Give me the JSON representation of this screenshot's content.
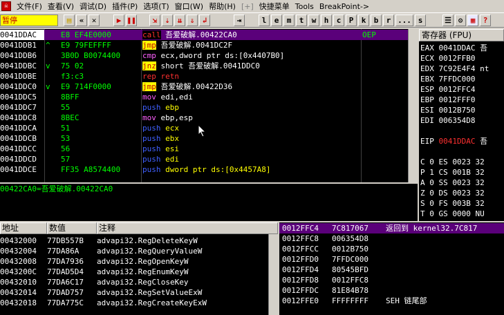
{
  "menu": {
    "app_icon": "app-logo-icon",
    "items": [
      "文件(F)",
      "查看(V)",
      "调试(D)",
      "插件(P)",
      "选项(T)",
      "窗口(W)",
      "帮助(H)",
      "[+]",
      "快捷菜单",
      "Tools",
      "BreakPoint->"
    ]
  },
  "toolbar": {
    "status": "暂停",
    "letters": [
      "l",
      "e",
      "m",
      "t",
      "w",
      "h",
      "c",
      "P",
      "k",
      "b",
      "r",
      "...",
      "s"
    ]
  },
  "disasm": {
    "rows": [
      {
        "addr": "0041DDAC",
        "mark": "",
        "hex": "E8 EF4E0000",
        "kw": "call",
        "kwclass": "kw-call",
        "op": " 吾爱破解.00422CA0",
        "cmt": "OEP",
        "sel": true
      },
      {
        "addr": "0041DDB1",
        "mark": "^",
        "hex": "E9 79FEFFFF",
        "kw": "jmp",
        "kwclass": "kw-jmp",
        "op": " 吾爱破解.0041DC2F",
        "cmt": "",
        "sel": false
      },
      {
        "addr": "0041DDB6",
        "mark": "",
        "hex": "3B0D B0074400",
        "kw": "cmp",
        "kwclass": "kw-cmp",
        "op": " ecx,dword ptr ds:[0x4407B0]",
        "cmt": "",
        "sel": false
      },
      {
        "addr": "0041DDBC",
        "mark": "v",
        "hex": "75 02",
        "kw": "jnz",
        "kwclass": "kw-jmp",
        "op": " short 吾爱破解.0041DDC0",
        "cmt": "",
        "sel": false
      },
      {
        "addr": "0041DDBE",
        "mark": "",
        "hex": "f3:c3",
        "kw": "rep retn",
        "kwclass": "kw-call",
        "op": "",
        "cmt": "",
        "sel": false
      },
      {
        "addr": "0041DDC0",
        "mark": "v",
        "hex": "E9 714F0000",
        "kw": "jmp",
        "kwclass": "kw-jmp",
        "op": " 吾爱破解.00422D36",
        "cmt": "",
        "sel": false
      },
      {
        "addr": "0041DDC5",
        "mark": "",
        "hex": "8BFF",
        "kw": "mov",
        "kwclass": "kw-mov",
        "op": " edi,edi",
        "cmt": "",
        "sel": false
      },
      {
        "addr": "0041DDC7",
        "mark": "",
        "hex": "55",
        "kw": "push",
        "kwclass": "kw-push",
        "op": " ebp",
        "cmt": "",
        "sel": false
      },
      {
        "addr": "0041DDC8",
        "mark": "",
        "hex": "8BEC",
        "kw": "mov",
        "kwclass": "kw-mov",
        "op": " ebp,esp",
        "cmt": "",
        "sel": false
      },
      {
        "addr": "0041DDCA",
        "mark": "",
        "hex": "51",
        "kw": "push",
        "kwclass": "kw-push",
        "op": " ecx",
        "cmt": "",
        "sel": false
      },
      {
        "addr": "0041DDCB",
        "mark": "",
        "hex": "53",
        "kw": "push",
        "kwclass": "kw-push",
        "op": " ebx",
        "cmt": "",
        "sel": false
      },
      {
        "addr": "0041DDCC",
        "mark": "",
        "hex": "56",
        "kw": "push",
        "kwclass": "kw-push",
        "op": " esi",
        "cmt": "",
        "sel": false
      },
      {
        "addr": "0041DDCD",
        "mark": "",
        "hex": "57",
        "kw": "push",
        "kwclass": "kw-push",
        "op": " edi",
        "cmt": "",
        "sel": false
      },
      {
        "addr": "0041DDCE",
        "mark": "",
        "hex": "FF35 A8574400",
        "kw": "push",
        "kwclass": "kw-push",
        "op": " dword ptr ds:[0x4457A8]",
        "cmt": "",
        "sel": false
      }
    ]
  },
  "info": {
    "line": "00422CA0=吾爱破解.00422CA0"
  },
  "registers": {
    "title": "寄存器 (FPU)",
    "rows": [
      {
        "name": "EAX",
        "val": "0041DDAC",
        "extra": " 吾",
        "red": false
      },
      {
        "name": "ECX",
        "val": "0012FFB0",
        "extra": "",
        "red": false
      },
      {
        "name": "EDX",
        "val": "7C92E4F4",
        "extra": " nt",
        "red": false
      },
      {
        "name": "EBX",
        "val": "7FFDC000",
        "extra": "",
        "red": false
      },
      {
        "name": "ESP",
        "val": "0012FFC4",
        "extra": "",
        "red": false
      },
      {
        "name": "EBP",
        "val": "0012FFF0",
        "extra": "",
        "red": false
      },
      {
        "name": "ESI",
        "val": "0012B750",
        "extra": "",
        "red": false
      },
      {
        "name": "EDI",
        "val": "006354D8",
        "extra": "",
        "red": false
      },
      {
        "name": "",
        "val": "",
        "extra": "",
        "red": false
      },
      {
        "name": "EIP",
        "val": "0041DDAC",
        "extra": " 吾",
        "red": true
      },
      {
        "name": "",
        "val": "",
        "extra": "",
        "red": false
      },
      {
        "name": "C 0",
        "val": "ES 0023",
        "extra": " 32",
        "red": false
      },
      {
        "name": "P 1",
        "val": "CS 001B",
        "extra": " 32",
        "red": false
      },
      {
        "name": "A 0",
        "val": "SS 0023",
        "extra": " 32",
        "red": false
      },
      {
        "name": "Z 0",
        "val": "DS 0023",
        "extra": " 32",
        "red": false
      },
      {
        "name": "S 0",
        "val": "FS 003B",
        "extra": " 32",
        "red": false
      },
      {
        "name": "T 0",
        "val": "GS 0000",
        "extra": " NU",
        "red": false
      }
    ]
  },
  "dump": {
    "headers": [
      "地址",
      "数值",
      "注释"
    ],
    "rows": [
      {
        "a": "00432000",
        "v": "77DB557B",
        "c": "advapi32.RegDeleteKeyW"
      },
      {
        "a": "00432004",
        "v": "77DA86A",
        "c": "advapi32.RegQueryValueW"
      },
      {
        "a": "00432008",
        "v": "77DA7936",
        "c": "advapi32.RegOpenKeyW"
      },
      {
        "a": "0043200C",
        "v": "77DAD5D4",
        "c": "advapi32.RegEnumKeyW"
      },
      {
        "a": "00432010",
        "v": "77DA6C17",
        "c": "advapi32.RegCloseKey"
      },
      {
        "a": "00432014",
        "v": "77DAD757",
        "c": "advapi32.RegSetValueExW"
      },
      {
        "a": "00432018",
        "v": "77DA775C",
        "c": "advapi32.RegCreateKeyExW"
      }
    ]
  },
  "stack": {
    "rows": [
      {
        "a": "0012FFC4",
        "v": "7C817067",
        "c": "返回到 kernel32.7C817",
        "sel": true
      },
      {
        "a": "0012FFC8",
        "v": "006354D8",
        "c": "",
        "sel": false
      },
      {
        "a": "0012FFCC",
        "v": "0012B750",
        "c": "",
        "sel": false
      },
      {
        "a": "0012FFD0",
        "v": "7FFDC000",
        "c": "",
        "sel": false
      },
      {
        "a": "0012FFD4",
        "v": "80545BFD",
        "c": "",
        "sel": false
      },
      {
        "a": "0012FFD8",
        "v": "0012FFC8",
        "c": "",
        "sel": false
      },
      {
        "a": "0012FFDC",
        "v": "81E84B78",
        "c": "",
        "sel": false
      },
      {
        "a": "0012FFE0",
        "v": "FFFFFFFF",
        "c": "SEH 链尾部",
        "sel": false
      }
    ]
  }
}
